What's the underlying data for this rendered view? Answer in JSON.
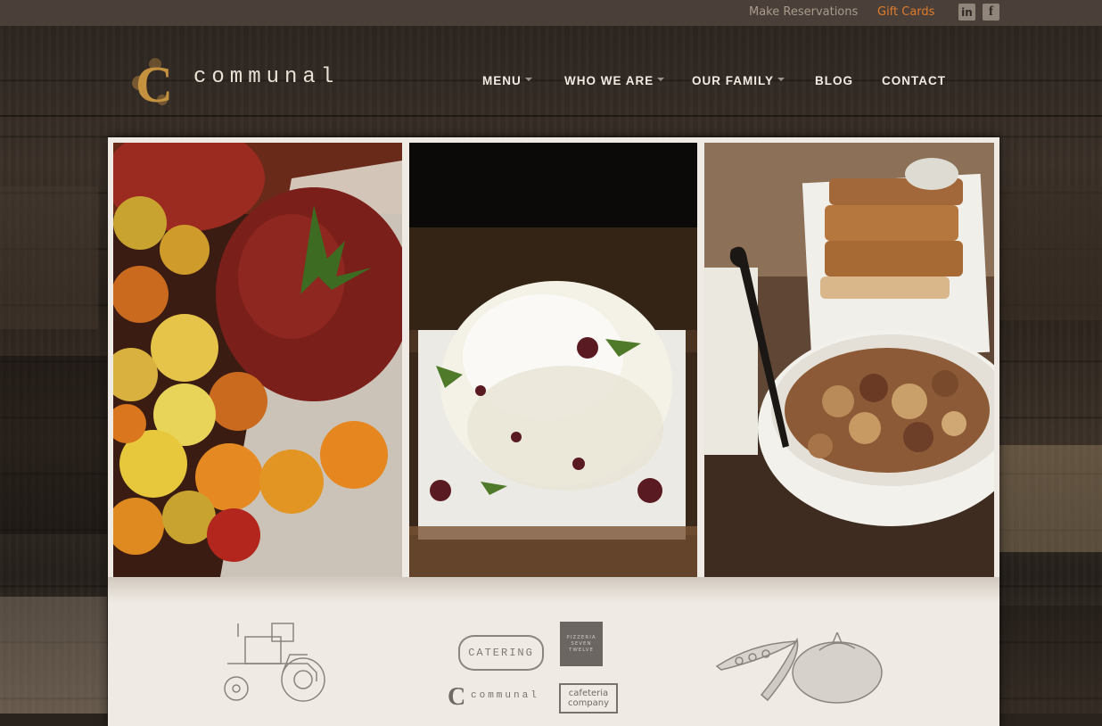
{
  "topbar": {
    "reservations": "Make Reservations",
    "gift_cards": "Gift Cards",
    "linkedin": "in",
    "facebook": "f",
    "gift_color": "#e07b2a"
  },
  "logo": {
    "mark": "C",
    "text": "communal"
  },
  "nav": {
    "items": [
      {
        "label": "MENU",
        "dropdown": true
      },
      {
        "label": "WHO WE ARE",
        "dropdown": true
      },
      {
        "label": "OUR FAMILY",
        "dropdown": true
      },
      {
        "label": "BLOG",
        "dropdown": false
      },
      {
        "label": "CONTACT",
        "dropdown": false
      }
    ]
  },
  "footer_logos": {
    "catering": "CATERING",
    "pizzeria": [
      "PIZZERIA",
      "SEVEN",
      "TWELVE"
    ],
    "communal_mark": "C",
    "communal_text": "communal",
    "cafeteria": [
      "cafeteria",
      "company"
    ]
  }
}
